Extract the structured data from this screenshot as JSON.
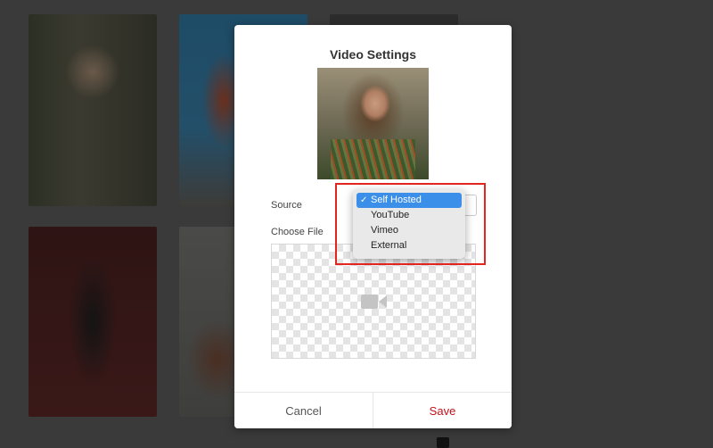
{
  "modal": {
    "title": "Video Settings",
    "source_label": "Source",
    "choose_file_label": "Choose File",
    "cancel_label": "Cancel",
    "save_label": "Save"
  },
  "dropdown": {
    "options": [
      "Self Hosted",
      "YouTube",
      "Vimeo",
      "External"
    ],
    "selected": "Self Hosted",
    "check_glyph": "✓"
  },
  "icons": {
    "dropzone_icon": "video-camera-icon"
  },
  "colors": {
    "save": "#c0111a",
    "selection": "#3b8fe8",
    "highlight": "#e3251f",
    "overlay": "#3a3a3a"
  }
}
